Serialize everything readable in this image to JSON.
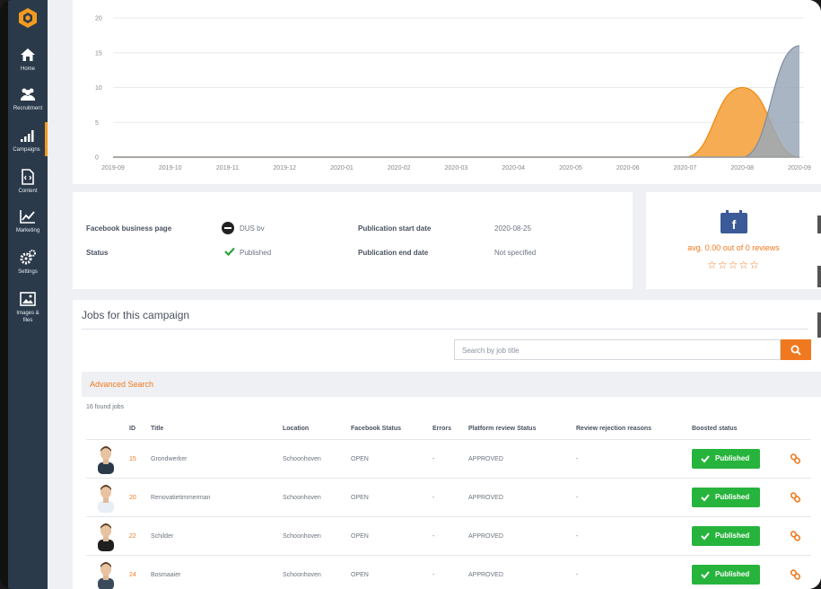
{
  "sidebar": {
    "items": [
      {
        "label": "Home",
        "icon": "home-icon"
      },
      {
        "label": "Recruitment",
        "icon": "users-icon"
      },
      {
        "label": "Campaigns",
        "icon": "bar-chart-icon"
      },
      {
        "label": "Content",
        "icon": "file-icon"
      },
      {
        "label": "Marketing",
        "icon": "trend-icon"
      },
      {
        "label": "Settings",
        "icon": "gear-icon"
      },
      {
        "label": "Images &",
        "label2": "files",
        "icon": "image-icon"
      }
    ],
    "active": "Campaigns"
  },
  "chart_data": {
    "type": "area",
    "categories": [
      "2019-09",
      "2019-10",
      "2019-11",
      "2019-12",
      "2020-01",
      "2020-02",
      "2020-03",
      "2020-04",
      "2020-05",
      "2020-06",
      "2020-07",
      "2020-08",
      "2020-09"
    ],
    "yticks": [
      "0",
      "5",
      "10",
      "15",
      "20"
    ],
    "ylim": [
      0,
      20
    ],
    "series": [
      {
        "values": [
          0,
          0,
          0,
          0,
          0,
          0,
          0,
          0,
          0,
          0,
          0,
          10,
          0
        ],
        "color": "#f5a340"
      },
      {
        "values": [
          0,
          0,
          0,
          0,
          0,
          0,
          0,
          0,
          0,
          0,
          0,
          0,
          16
        ],
        "color": "#9aa8b8"
      }
    ],
    "grid": true
  },
  "info": {
    "fb_page_label": "Facebook business page",
    "fb_page_value": "DUS bv",
    "status_label": "Status",
    "status_value": "Published",
    "pub_start_label": "Publication start date",
    "pub_start_value": "2020-08-25",
    "pub_end_label": "Publication end date",
    "pub_end_value": "Not specified"
  },
  "review": {
    "text": "avg. 0.00 out of 0 reviews",
    "stars": "☆☆☆☆☆",
    "icon": "facebook-icon"
  },
  "jobs": {
    "title": "Jobs for this campaign",
    "search_placeholder": "Search by job title",
    "advanced": "Advanced Search",
    "found": "16 found jobs",
    "headers": {
      "id": "ID",
      "title": "Title",
      "location": "Location",
      "fb_status": "Facebook Status",
      "errors": "Errors",
      "platform": "Platform review Status",
      "rejection": "Review rejection reasons",
      "boosted": "Boosted status"
    },
    "rows": [
      {
        "id": "15",
        "title": "Grondwerker",
        "location": "Schoonhoven",
        "fb_status": "OPEN",
        "errors": "-",
        "platform": "APPROVED",
        "rejection": "-",
        "boosted": "Published"
      },
      {
        "id": "20",
        "title": "Renovatietimmerman",
        "location": "Schoonhoven",
        "fb_status": "OPEN",
        "errors": "-",
        "platform": "APPROVED",
        "rejection": "-",
        "boosted": "Published"
      },
      {
        "id": "22",
        "title": "Schilder",
        "location": "Schoonhoven",
        "fb_status": "OPEN",
        "errors": "-",
        "platform": "APPROVED",
        "rejection": "-",
        "boosted": "Published"
      },
      {
        "id": "24",
        "title": "Bosmaaier",
        "location": "Schoonhoven",
        "fb_status": "OPEN",
        "errors": "-",
        "platform": "APPROVED",
        "rejection": "-",
        "boosted": "Published"
      }
    ]
  },
  "colors": {
    "accent": "#f0791f",
    "success": "#27b43c",
    "sidebar": "#2b3a4a"
  }
}
